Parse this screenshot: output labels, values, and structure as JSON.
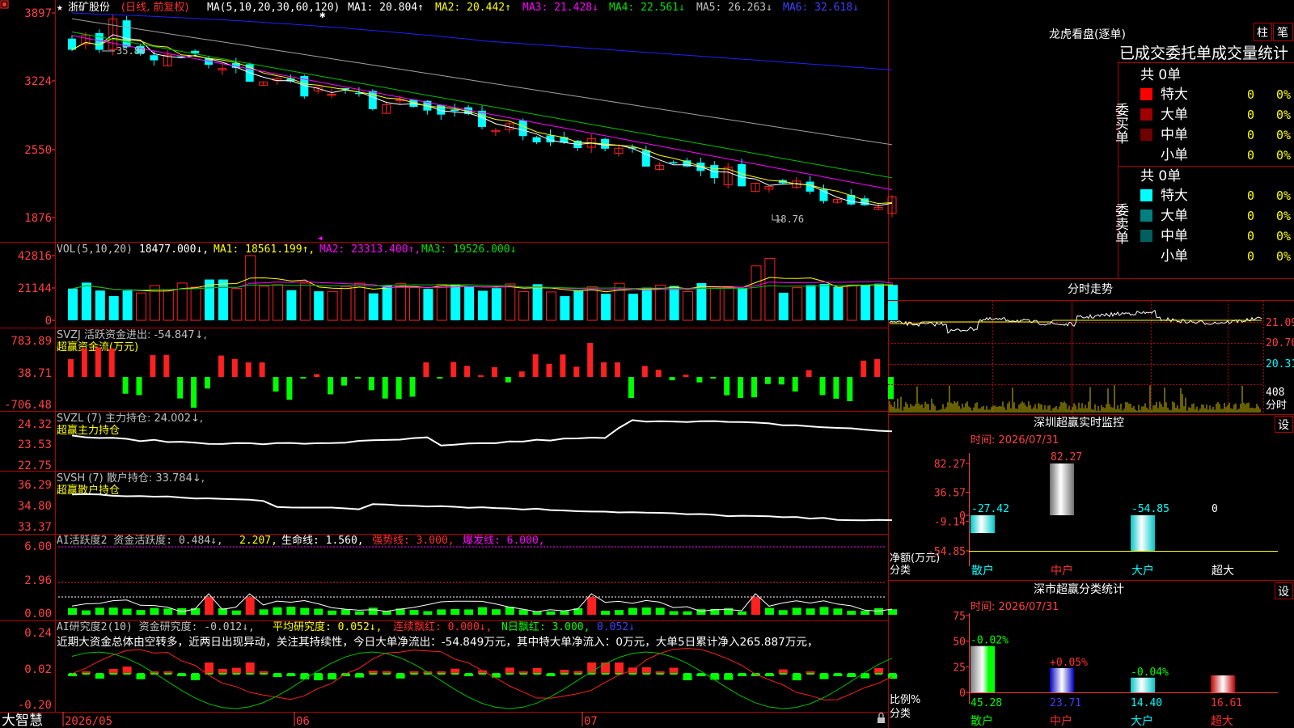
{
  "app": {
    "brand": "大智慧",
    "corner_icon": "close-square-icon",
    "lock_icon": "lock-icon"
  },
  "colors": {
    "up": "#ff2020",
    "down": "#00ffff",
    "grid": "#b00000",
    "axis_text": "#ff4040",
    "ma1": "#ffffff",
    "ma2": "#ffff00",
    "ma3": "#ff00ff",
    "ma4": "#00c000",
    "ma5": "#a0a0a0",
    "ma6": "#2020ff"
  },
  "main": {
    "star": "★",
    "stock_name": "浙矿股份",
    "period": "(日线, 前复权)",
    "ma_params": "MA(5,10,20,30,60,120)",
    "ma": [
      {
        "label": "MA1: 20.804↑",
        "color": "#ffffff"
      },
      {
        "label": "MA2: 20.442↑",
        "color": "#ffff00"
      },
      {
        "label": "MA3: 21.428↓",
        "color": "#ff00ff"
      },
      {
        "label": "MA4: 22.561↓",
        "color": "#00c000"
      },
      {
        "label": "MA5: 26.263↓",
        "color": "#c0c0c0"
      },
      {
        "label": "MA6: 32.618↓",
        "color": "#3030ff"
      }
    ],
    "y_labels": [
      "3897",
      "3224",
      "2550",
      "1876"
    ],
    "high_note": "35.80",
    "low_note": "18.76"
  },
  "vol": {
    "header": "VOL(5,10,20)",
    "value": "18477.000↓,",
    "ma1": "MA1: 18561.199↑,",
    "ma2": "MA2: 23313.400↑,",
    "ma3": "MA3: 19526.000↓",
    "y_labels": [
      "42816",
      "21144",
      "0"
    ]
  },
  "svzj": {
    "header": "SVZJ  活跃资金进出: -54.847↓,",
    "sub": "超赢资金流(万元)",
    "y_labels": [
      "783.89",
      "38.71",
      "-706.48"
    ]
  },
  "svzl": {
    "header": "SVZL (7) 主力持仓: 24.002↓,",
    "sub": "超赢主力持仓",
    "y_labels": [
      "24.32",
      "23.53",
      "22.75"
    ]
  },
  "svsh": {
    "header": "SVSH (7) 散户持仓: 33.784↓,",
    "sub": "超赢散户持仓",
    "y_labels": [
      "36.29",
      "34.80",
      "33.37"
    ]
  },
  "ai_active": {
    "header_a": "AI活跃度2 资金活跃度: 0.484↓,",
    "header_b": "2.207,",
    "header_c": "生命线: 1.560,",
    "header_d": "强势线: 3.000,",
    "header_e": "爆发线: 6.000,",
    "y_labels": [
      "6.00",
      "2.96",
      "0.00"
    ]
  },
  "ai_research": {
    "header_a": "AI研究度2(10) 资金研究度: -0.012↓,",
    "header_b": "平均研究度: 0.052↓,",
    "header_c": "连续飘红: 0.000↓,",
    "header_d": "N日飘红: 3.000,",
    "header_e": "0.052↓",
    "commentary": "近期大资金总体由空转多，近两日出现异动，关注其持续性，今日大单净流出：-54.849万元，其中特大单净流入：0万元，大单5日累计净入265.887万元，",
    "y_labels": [
      "0.24",
      "0.02",
      "-0.20"
    ]
  },
  "x_axis": {
    "labels": [
      "2026/05",
      "06",
      "07"
    ]
  },
  "lhb": {
    "title": "龙虎看盘(逐单)",
    "btn_bar": "柱",
    "btn_pen": "笔",
    "tabs": "已成交委托单成交量统计",
    "buy": {
      "side": "委买单",
      "total": "共 0单",
      "rows": [
        {
          "label": "特大",
          "count": "0",
          "pct": "0%",
          "color": "#ff0000"
        },
        {
          "label": "大单",
          "count": "0",
          "pct": "0%",
          "color": "#a00000"
        },
        {
          "label": "中单",
          "count": "0",
          "pct": "0%",
          "color": "#700000"
        },
        {
          "label": "小单",
          "count": "0",
          "pct": "0%",
          "color": ""
        }
      ]
    },
    "sell": {
      "side": "委卖单",
      "total": "共 0单",
      "rows": [
        {
          "label": "特大",
          "count": "0",
          "pct": "0%",
          "color": "#00ffff"
        },
        {
          "label": "大单",
          "count": "0",
          "pct": "0%",
          "color": "#008080"
        },
        {
          "label": "中单",
          "count": "0",
          "pct": "0%",
          "color": "#006060"
        },
        {
          "label": "小单",
          "count": "0",
          "pct": "0%",
          "color": ""
        }
      ]
    }
  },
  "intraday": {
    "title": "分时走势",
    "y_labels": [
      "21.09",
      "20.70",
      "20.31"
    ],
    "vol_labels": [
      "408",
      "分时"
    ]
  },
  "monitor": {
    "title": "深圳超赢实时监控",
    "set_btn": "设",
    "time": "时间: 2026/07/31",
    "y_labels": [
      "82.27",
      "36.57",
      "0",
      "-9.14",
      "-54.85"
    ],
    "net_label": "净额(万元)",
    "cat_label": "分类",
    "categories": [
      "散户",
      "中户",
      "大户",
      "超大"
    ]
  },
  "classify": {
    "title": "深市超赢分类统计",
    "set_btn": "设",
    "time": "时间: 2026/07/31",
    "y_labels": [
      "75",
      "50",
      "25",
      "0"
    ],
    "ratio_label": "比例%",
    "cat_label": "分类",
    "categories": [
      "散户",
      "中户",
      "大户",
      "超大"
    ]
  },
  "chart_data": [
    {
      "type": "candlestick",
      "name": "price",
      "ma_lines": [
        "MA1",
        "MA2",
        "MA3",
        "MA4",
        "MA5",
        "MA6"
      ],
      "high": 35.8,
      "low": 18.76,
      "y_ticks": [
        "3897",
        "3224",
        "2550",
        "1876"
      ],
      "x_labels": [
        "2026/05",
        "06",
        "07"
      ]
    },
    {
      "type": "bar",
      "name": "VOL",
      "y_ticks": [
        42816,
        21144,
        0
      ],
      "ma": {
        "MA1": 18561.199,
        "MA2": 23313.4,
        "MA3": 19526.0
      },
      "last": 18477.0
    },
    {
      "type": "bar",
      "name": "SVZJ",
      "y_ticks": [
        783.89,
        38.71,
        -706.48
      ],
      "last": -54.847
    },
    {
      "type": "line",
      "name": "SVZL",
      "y_ticks": [
        24.32,
        23.53,
        22.75
      ],
      "last": 24.002
    },
    {
      "type": "line",
      "name": "SVSH",
      "y_ticks": [
        36.29,
        34.8,
        33.37
      ],
      "last": 33.784
    },
    {
      "type": "bar",
      "name": "AI活跃度2",
      "y_ticks": [
        6.0,
        2.96,
        0.0
      ],
      "values": {
        "资金活跃度": 0.484,
        "second": 2.207,
        "生命线": 1.56,
        "强势线": 3.0,
        "爆发线": 6.0
      }
    },
    {
      "type": "bar",
      "name": "AI研究度2",
      "y_ticks": [
        0.24,
        0.02,
        -0.2
      ],
      "values": {
        "资金研究度": -0.012,
        "平均研究度": 0.052,
        "连续飘红": 0.0,
        "N日飘红": 3.0
      }
    },
    {
      "type": "bar",
      "name": "深圳超赢实时监控",
      "categories": [
        "散户",
        "中户",
        "大户",
        "超大"
      ],
      "values": [
        -27.42,
        82.27,
        -54.85,
        0
      ],
      "y_ticks": [
        82.27,
        36.57,
        0,
        -9.14,
        -54.85
      ]
    },
    {
      "type": "bar",
      "name": "深市超赢分类统计",
      "categories": [
        "散户",
        "中户",
        "大户",
        "超大"
      ],
      "values": [
        45.28,
        23.71,
        14.4,
        16.61
      ],
      "changes": [
        "-0.02%",
        "+0.05%",
        "-0.04%",
        ""
      ],
      "y_ticks": [
        75,
        50,
        25,
        0
      ]
    }
  ]
}
